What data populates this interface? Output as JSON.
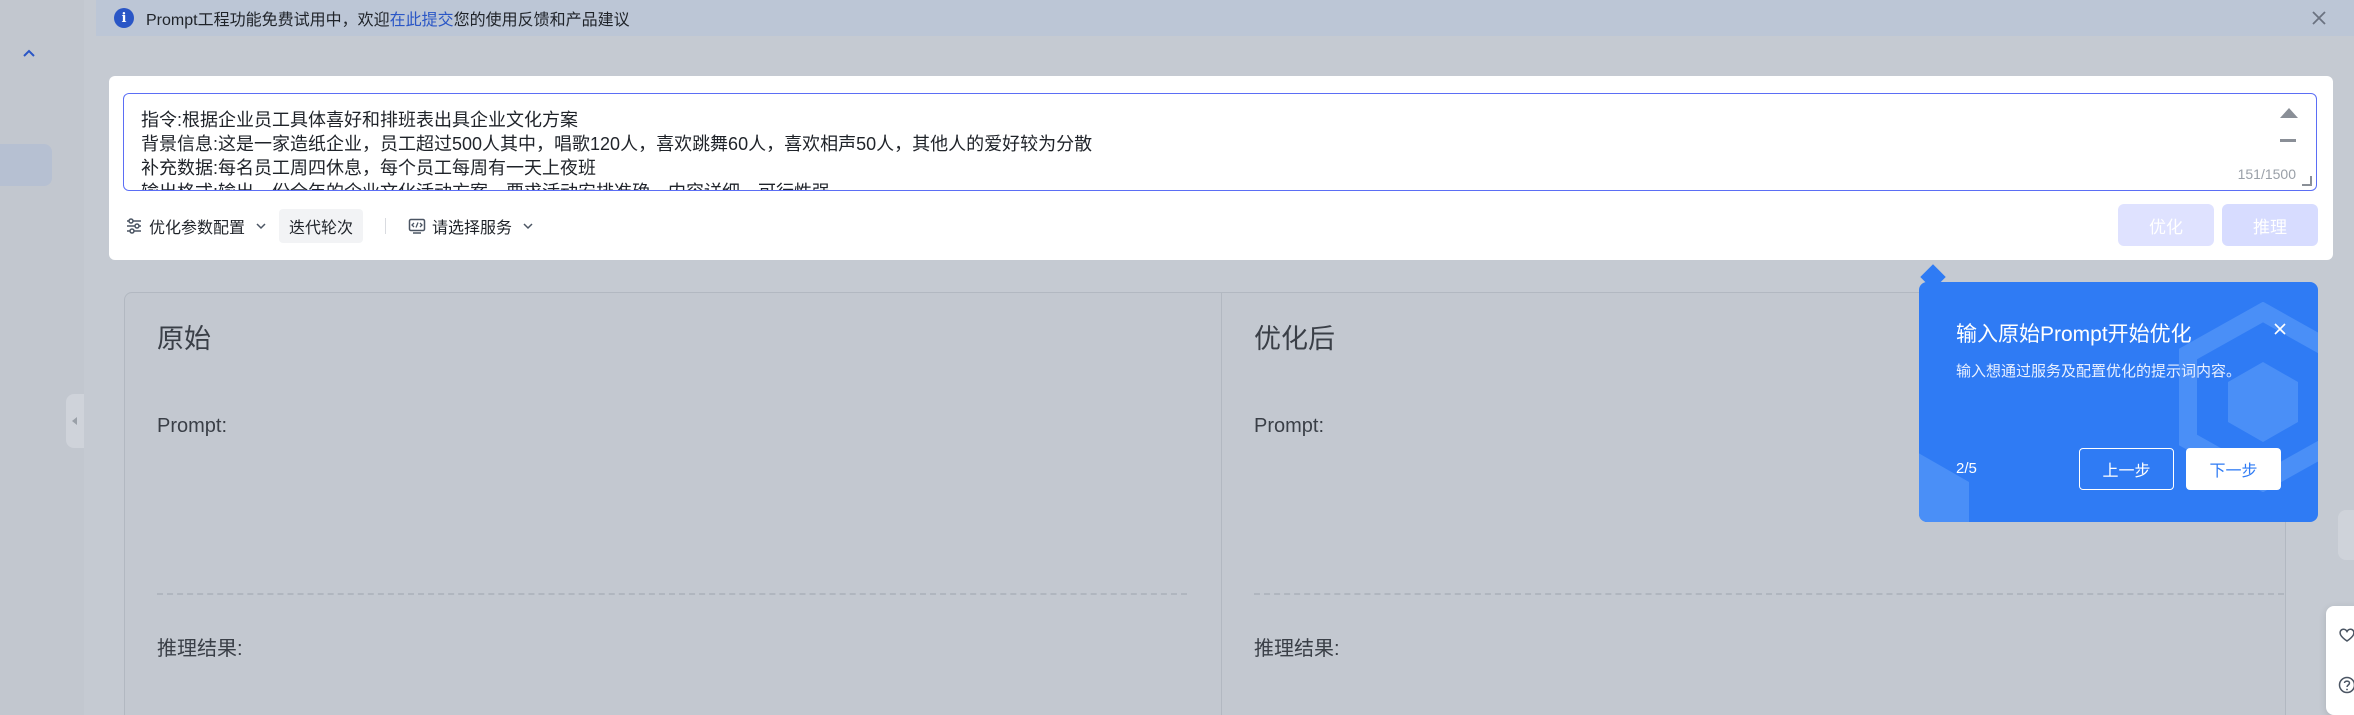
{
  "notice": {
    "text_before": "Prompt工程功能免费试用中，欢迎",
    "link": "在此提交",
    "text_after": "您的使用反馈和产品建议"
  },
  "prompt_input": {
    "lines": [
      "指令:根据企业员工具体喜好和排班表出具企业文化方案",
      "背景信息:这是一家造纸企业，员工超过500人其中，唱歌120人，喜欢跳舞60人，喜欢相声50人，其他人的爱好较为分散",
      "补充数据:每名员工周四休息，每个员工每周有一天上夜班",
      "输出格式:输出一份全年的企业文化活动方案，要求活动安排准确，内容详细，可行性强"
    ],
    "char_count": "151/1500"
  },
  "toolbar": {
    "params_label": "优化参数配置",
    "iteration_label": "迭代轮次",
    "service_label": "请选择服务",
    "optimize_button": "优化",
    "infer_button": "推理"
  },
  "panels": {
    "original": {
      "title": "原始",
      "prompt_label": "Prompt:",
      "result_label": "推理结果:"
    },
    "optimized": {
      "title": "优化后",
      "prompt_label": "Prompt:",
      "result_label": "推理结果:"
    }
  },
  "guide": {
    "title": "输入原始Prompt开始优化",
    "description": "输入想通过服务及配置优化的提示词内容。",
    "step": "2/5",
    "prev_button": "上一步",
    "next_button": "下一步"
  },
  "colors": {
    "accent": "#2f7bf4",
    "input_border": "#5b6ef5",
    "overlay_bg": "#c5cad2"
  }
}
